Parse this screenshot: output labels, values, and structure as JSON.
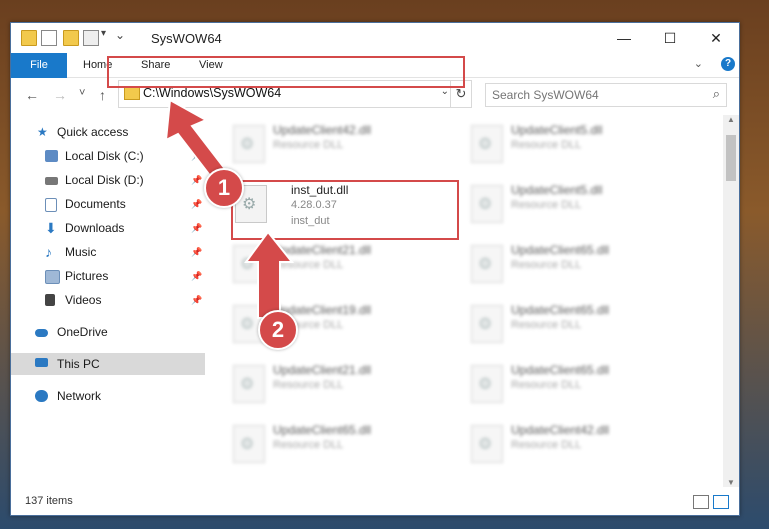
{
  "window": {
    "title": "SysWOW64"
  },
  "ribbon": {
    "tabs": [
      "File",
      "Home",
      "Share",
      "View"
    ],
    "help_label": "?"
  },
  "nav": {
    "back_icon": "←",
    "forward_icon": "→",
    "recent_icon": "˅",
    "up_icon": "↑",
    "address_path": "C:\\Windows\\SysWOW64",
    "search_placeholder": "Search SysWOW64"
  },
  "sidebar": {
    "items": [
      {
        "label": "Quick access",
        "icon": "star-icon",
        "color": "#2b79c2"
      },
      {
        "label": "Local Disk (C:)",
        "icon": "drive-icon",
        "color": "#5d8bc4"
      },
      {
        "label": "Local Disk (D:)",
        "icon": "drive-icon",
        "color": "#777777"
      },
      {
        "label": "Documents",
        "icon": "documents-icon",
        "color": "#6c8fb8"
      },
      {
        "label": "Downloads",
        "icon": "download-icon",
        "color": "#2b79c2"
      },
      {
        "label": "Music",
        "icon": "music-icon",
        "color": "#2b79c2"
      },
      {
        "label": "Pictures",
        "icon": "pictures-icon",
        "color": "#6c8fb8"
      },
      {
        "label": "Videos",
        "icon": "videos-icon",
        "color": "#444444"
      },
      {
        "label": "OneDrive",
        "icon": "cloud-icon",
        "color": "#2b79c2"
      },
      {
        "label": "This PC",
        "icon": "computer-icon",
        "color": "#2b79c2"
      },
      {
        "label": "Network",
        "icon": "network-icon",
        "color": "#2b79c2"
      }
    ]
  },
  "files": [
    {
      "name": "UpdateClient42.dll",
      "type": "Resource DLL"
    },
    {
      "name": "UpdateClient5.dll",
      "type": "Resource DLL"
    },
    {
      "name": "inst_dut.dll",
      "version": "4.28.0.37",
      "desc": "inst_dut"
    },
    {
      "name": "UpdateClient5.dll",
      "type": "Resource DLL"
    },
    {
      "name": "UpdateClient21.dll",
      "type": "Resource DLL"
    },
    {
      "name": "UpdateClient65.dll",
      "type": "Resource DLL"
    },
    {
      "name": "UpdateClient19.dll",
      "type": "Resource DLL"
    },
    {
      "name": "UpdateClient65.dll",
      "type": "Resource DLL"
    },
    {
      "name": "UpdateClient21.dll",
      "type": "Resource DLL"
    },
    {
      "name": "UpdateClient65.dll",
      "type": "Resource DLL"
    },
    {
      "name": "UpdateClient65.dll",
      "type": "Resource DLL"
    },
    {
      "name": "UpdateClient42.dll",
      "type": "Resource DLL"
    }
  ],
  "status": {
    "item_count": "137 items"
  },
  "annotations": {
    "step1": "1",
    "step2": "2",
    "accent": "#d44a4a"
  }
}
